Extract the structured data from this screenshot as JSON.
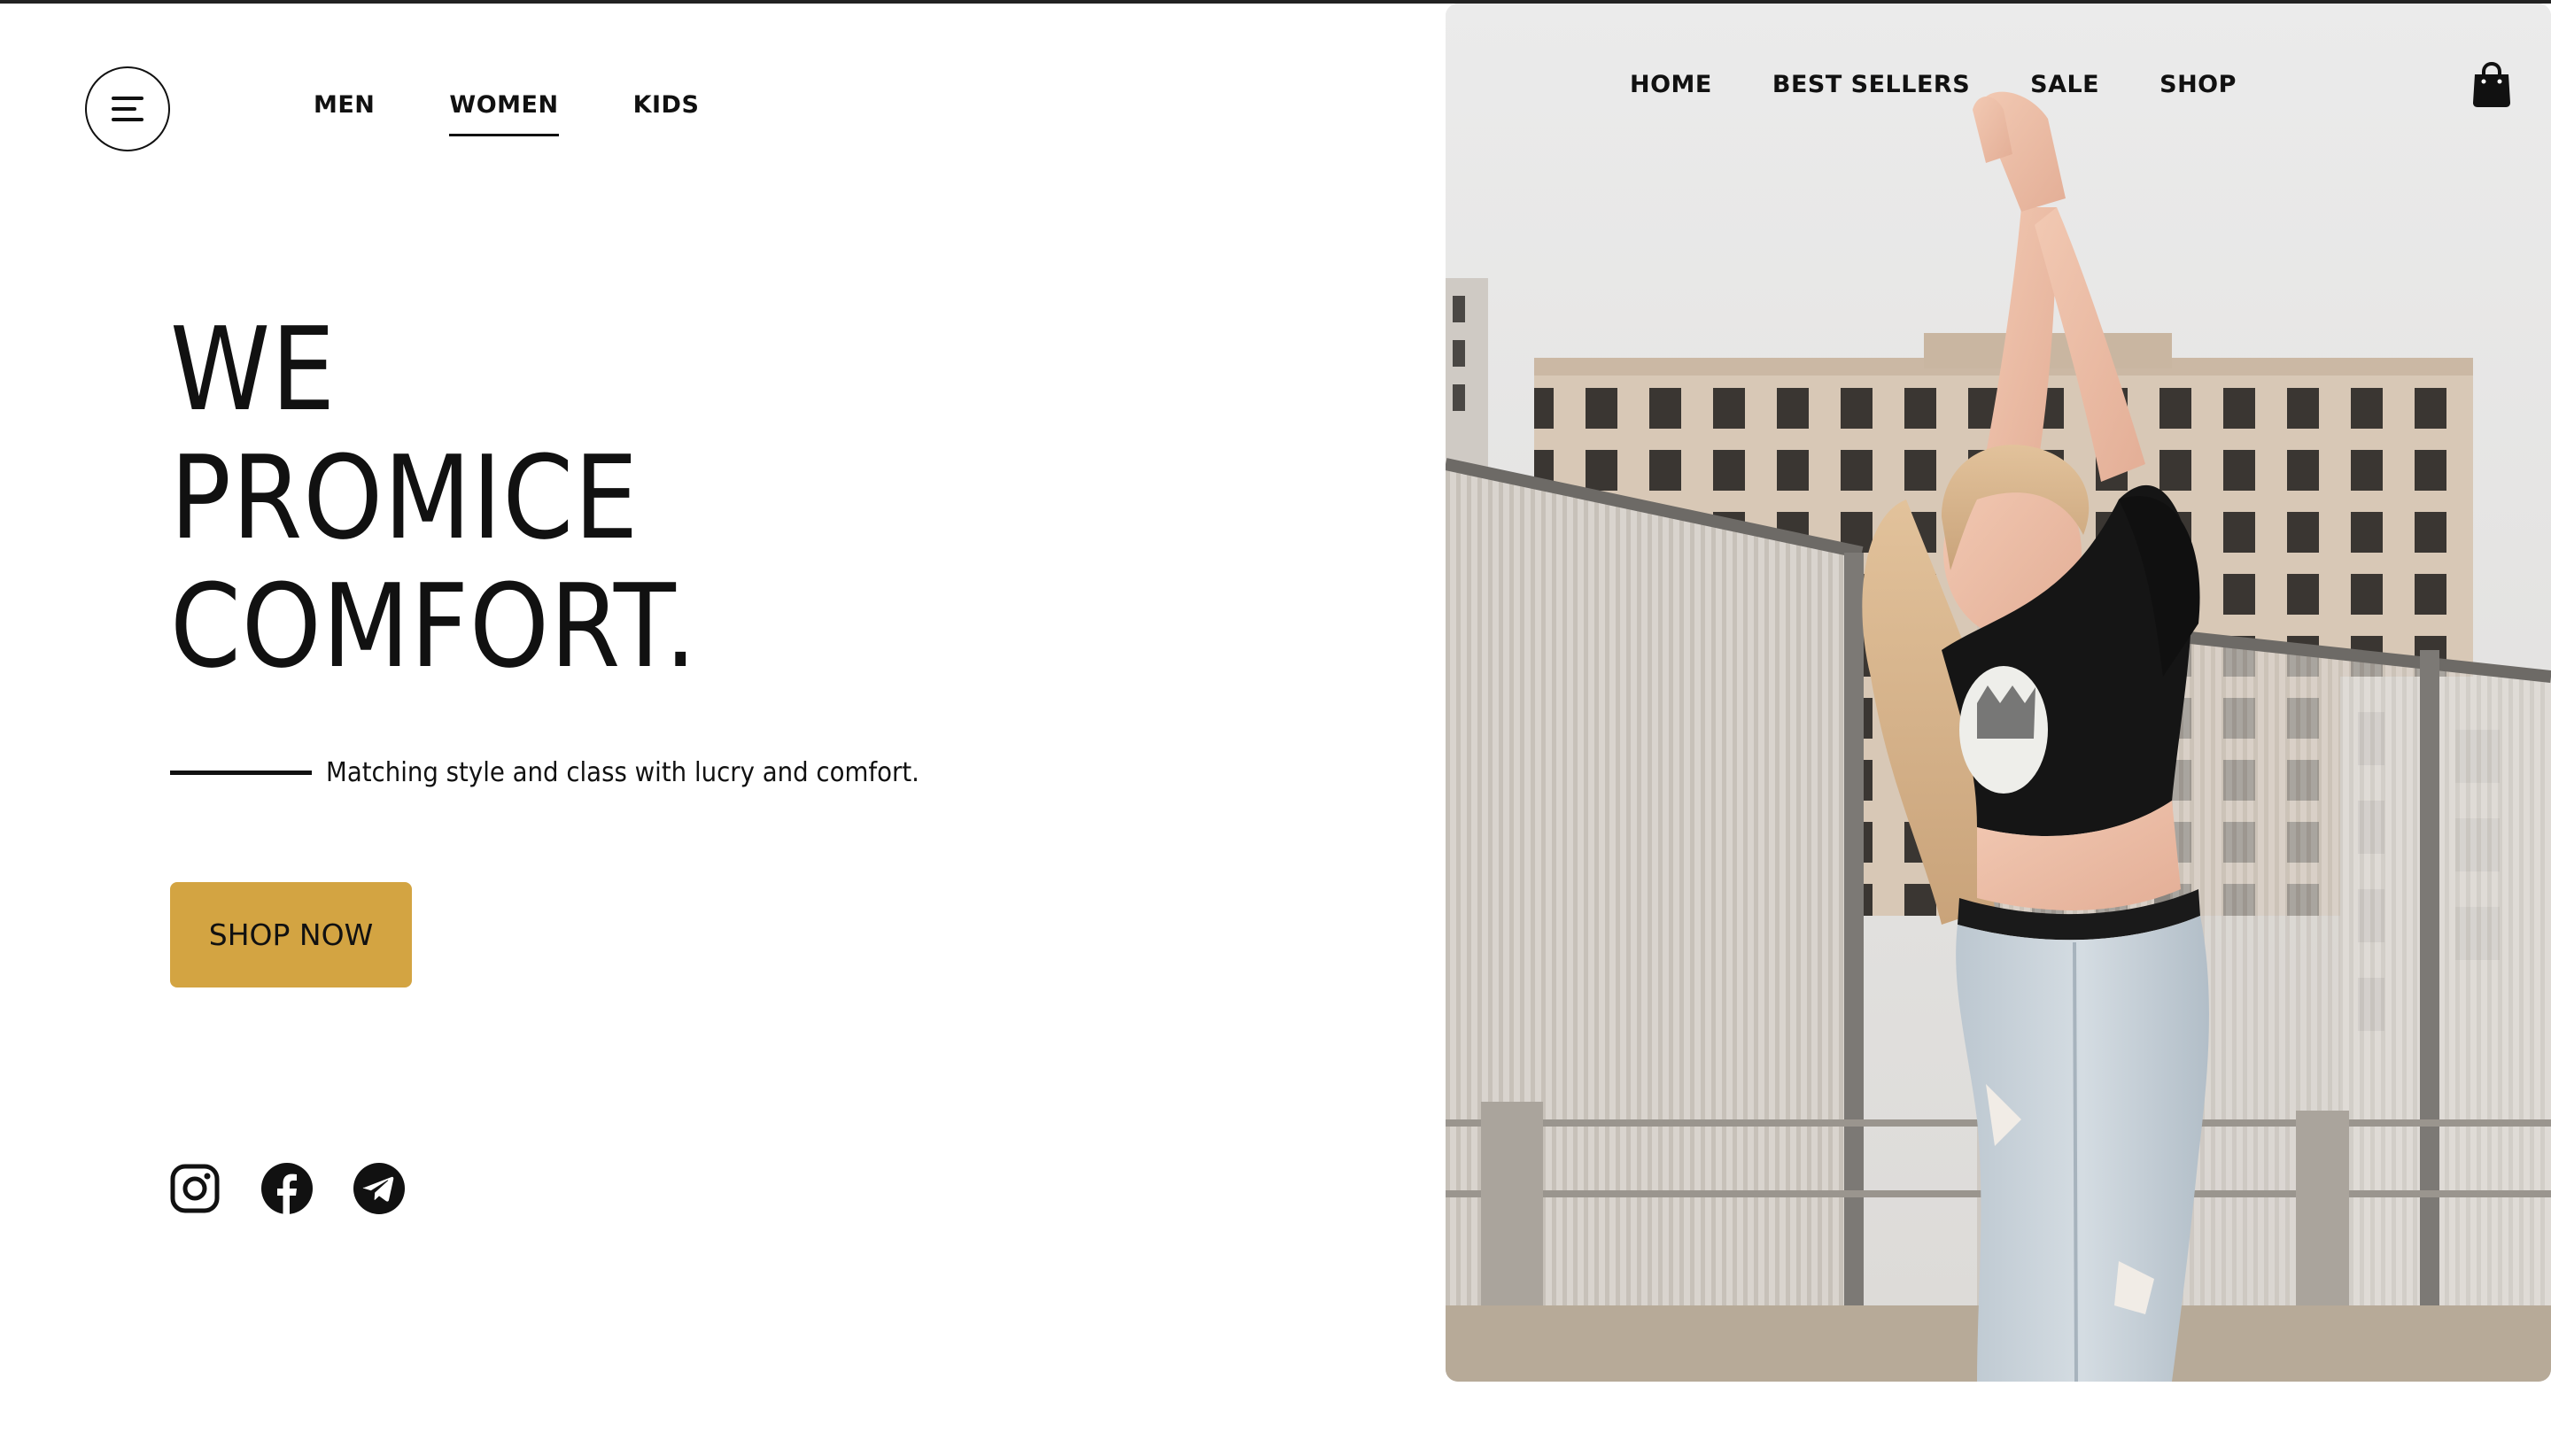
{
  "header": {
    "categories": [
      {
        "label": "MEN",
        "active": false
      },
      {
        "label": "WOMEN",
        "active": true
      },
      {
        "label": "KIDS",
        "active": false
      }
    ],
    "nav": [
      "HOME",
      "BEST SELLERS",
      "SALE",
      "SHOP"
    ],
    "menu_icon": "hamburger-menu-icon",
    "cart_icon": "shopping-bag-icon"
  },
  "hero": {
    "headline": [
      "WE",
      "PROMICE",
      "COMFORT."
    ],
    "tagline": "Matching style and class with lucry and comfort.",
    "cta_label": "SHOP NOW",
    "image_icon": "hero-photo-model-icon"
  },
  "socials": [
    {
      "name": "instagram-icon"
    },
    {
      "name": "facebook-icon"
    },
    {
      "name": "telegram-icon"
    }
  ],
  "colors": {
    "accent": "#d3a442",
    "text": "#111111",
    "background": "#ffffff"
  }
}
